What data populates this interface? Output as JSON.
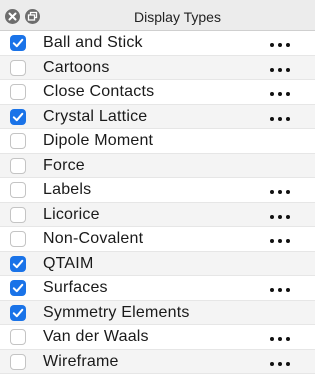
{
  "panel": {
    "title": "Display Types",
    "accent_color": "#1a73e8"
  },
  "titlebar": {
    "close_icon": "close-icon",
    "float_icon": "float-icon"
  },
  "display_types": [
    {
      "label": "Ball and Stick",
      "checked": true,
      "has_options": true
    },
    {
      "label": "Cartoons",
      "checked": false,
      "has_options": true
    },
    {
      "label": "Close Contacts",
      "checked": false,
      "has_options": true
    },
    {
      "label": "Crystal Lattice",
      "checked": true,
      "has_options": true
    },
    {
      "label": "Dipole Moment",
      "checked": false,
      "has_options": false
    },
    {
      "label": "Force",
      "checked": false,
      "has_options": false
    },
    {
      "label": "Labels",
      "checked": false,
      "has_options": true
    },
    {
      "label": "Licorice",
      "checked": false,
      "has_options": true
    },
    {
      "label": "Non-Covalent",
      "checked": false,
      "has_options": true
    },
    {
      "label": "QTAIM",
      "checked": true,
      "has_options": false
    },
    {
      "label": "Surfaces",
      "checked": true,
      "has_options": true
    },
    {
      "label": "Symmetry Elements",
      "checked": true,
      "has_options": false
    },
    {
      "label": "Van der Waals",
      "checked": false,
      "has_options": true
    },
    {
      "label": "Wireframe",
      "checked": false,
      "has_options": true
    }
  ]
}
